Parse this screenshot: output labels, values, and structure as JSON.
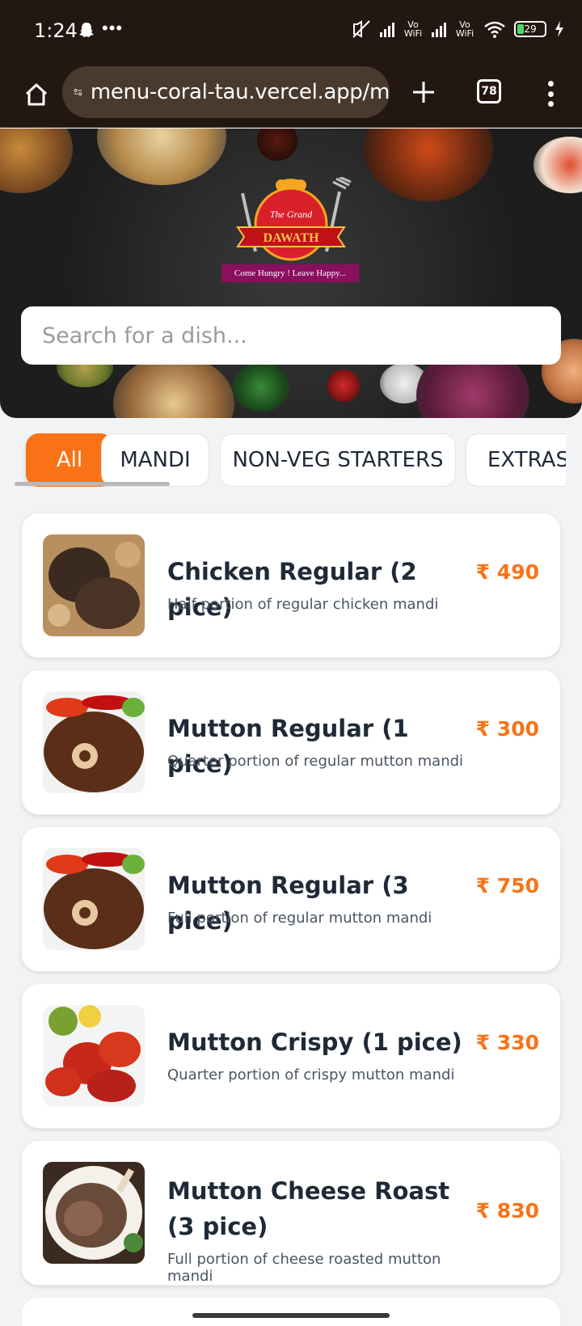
{
  "status_bar": {
    "time": "1:24",
    "vo_wifi_1": "Vo WiFi",
    "vo_wifi_2": "Vo WiFi",
    "battery": "29"
  },
  "browser": {
    "url": "menu-coral-tau.vercel.app/m",
    "tab_count": "78"
  },
  "hero": {
    "logo_text_top": "The Grand",
    "logo_text_main": "DAWATH",
    "tagline": "Come Hungry ! Leave Happy...",
    "search_placeholder": "Search for a dish..."
  },
  "categories": [
    {
      "label": "All",
      "active": true
    },
    {
      "label": "MANDI",
      "active": false
    },
    {
      "label": "NON-VEG STARTERS",
      "active": false
    },
    {
      "label": "EXTRAS",
      "active": false
    }
  ],
  "dishes": [
    {
      "name": "Chicken Regular (2 pice)",
      "description": "Half portion of regular chicken mandi",
      "price": "₹ 490"
    },
    {
      "name": "Mutton Regular (1 pice)",
      "description": "Quarter portion of regular mutton mandi",
      "price": "₹ 300"
    },
    {
      "name": "Mutton Regular (3 pice)",
      "description": "Full portion of regular mutton mandi",
      "price": "₹ 750"
    },
    {
      "name": "Mutton Crispy (1 pice)",
      "description": "Quarter portion of crispy mutton mandi",
      "price": "₹ 330"
    },
    {
      "name": "Mutton Cheese Roast (3 pice)",
      "description": "Full portion of cheese roasted mutton mandi",
      "price": "₹ 830"
    }
  ],
  "colors": {
    "accent": "#f97316",
    "browser_chrome": "#231712",
    "tagline_bg": "#8a0f5e"
  }
}
